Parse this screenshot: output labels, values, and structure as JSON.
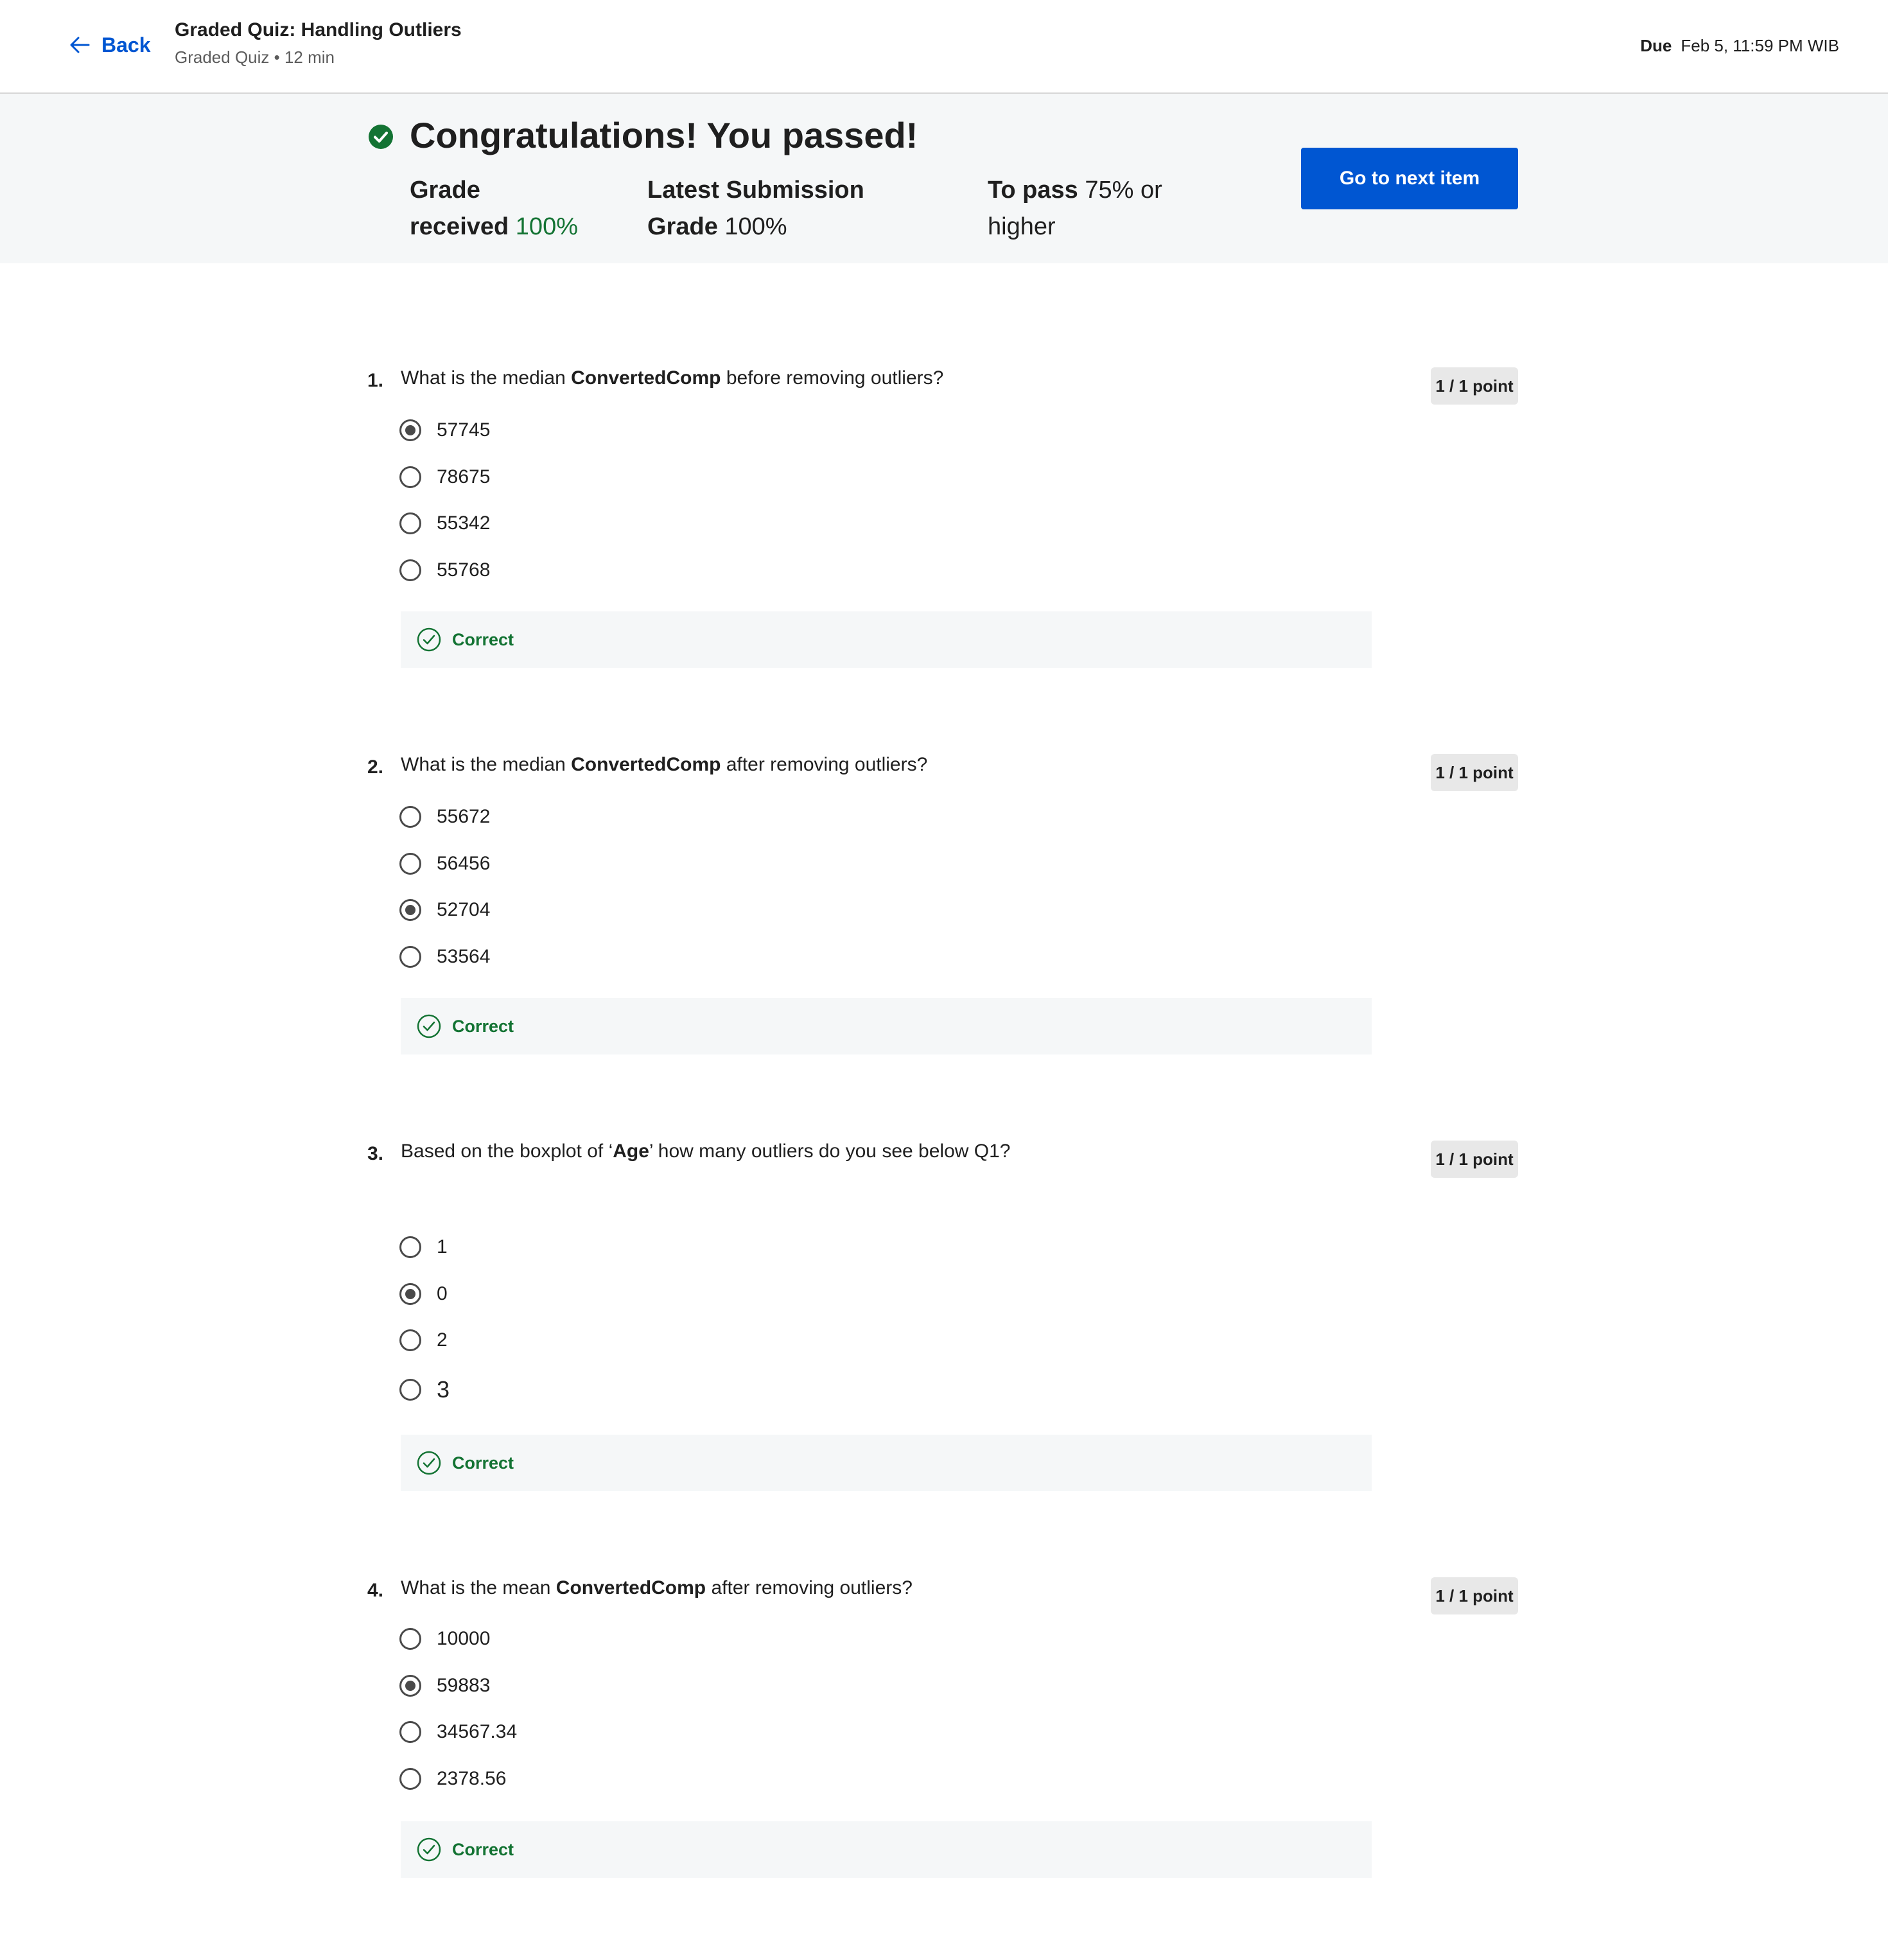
{
  "header": {
    "back_label": "Back",
    "title": "Graded Quiz: Handling Outliers",
    "subtitle": "Graded Quiz • 12 min",
    "due_label": "Due",
    "due_value": "Feb 5, 11:59 PM WIB"
  },
  "banner": {
    "headline": "Congratulations! You passed!",
    "grade_label_1": "Grade",
    "grade_label_2": "received",
    "grade_value": "100%",
    "latest_label_1": "Latest Submission",
    "latest_label_2": "Grade",
    "latest_value": "100%",
    "pass_label": "To pass",
    "pass_value_1": "75% or",
    "pass_value_2": "higher",
    "next_button": "Go to next item",
    "accent_color": "#137333",
    "button_color": "#0056d2"
  },
  "questions": [
    {
      "number": "1.",
      "text_before": "What is the median ",
      "text_bold": "ConvertedComp",
      "text_after": " before removing outliers?",
      "points": "1 / 1 point",
      "options": [
        "57745",
        "78675",
        "55342",
        "55768"
      ],
      "selected_index": 0,
      "feedback": "Correct"
    },
    {
      "number": "2.",
      "text_before": "What is the median ",
      "text_bold": "ConvertedComp",
      "text_after": " after removing outliers?",
      "points": "1 / 1 point",
      "options": [
        "55672",
        "56456",
        "52704",
        "53564"
      ],
      "selected_index": 2,
      "feedback": "Correct"
    },
    {
      "number": "3.",
      "text_before": "Based on the boxplot of ‘",
      "text_bold": "Age",
      "text_after": "’ how many outliers do you see below Q1?",
      "points": "1 / 1 point",
      "options": [
        "1",
        "0",
        "2",
        "3"
      ],
      "selected_index": 1,
      "feedback": "Correct"
    },
    {
      "number": "4.",
      "text_before": "What is the mean ",
      "text_bold": "ConvertedComp",
      "text_after": " after removing outliers?",
      "points": "1 / 1 point",
      "options": [
        "10000",
        "59883",
        "34567.34",
        "2378.56"
      ],
      "selected_index": 1,
      "feedback": "Correct"
    }
  ]
}
